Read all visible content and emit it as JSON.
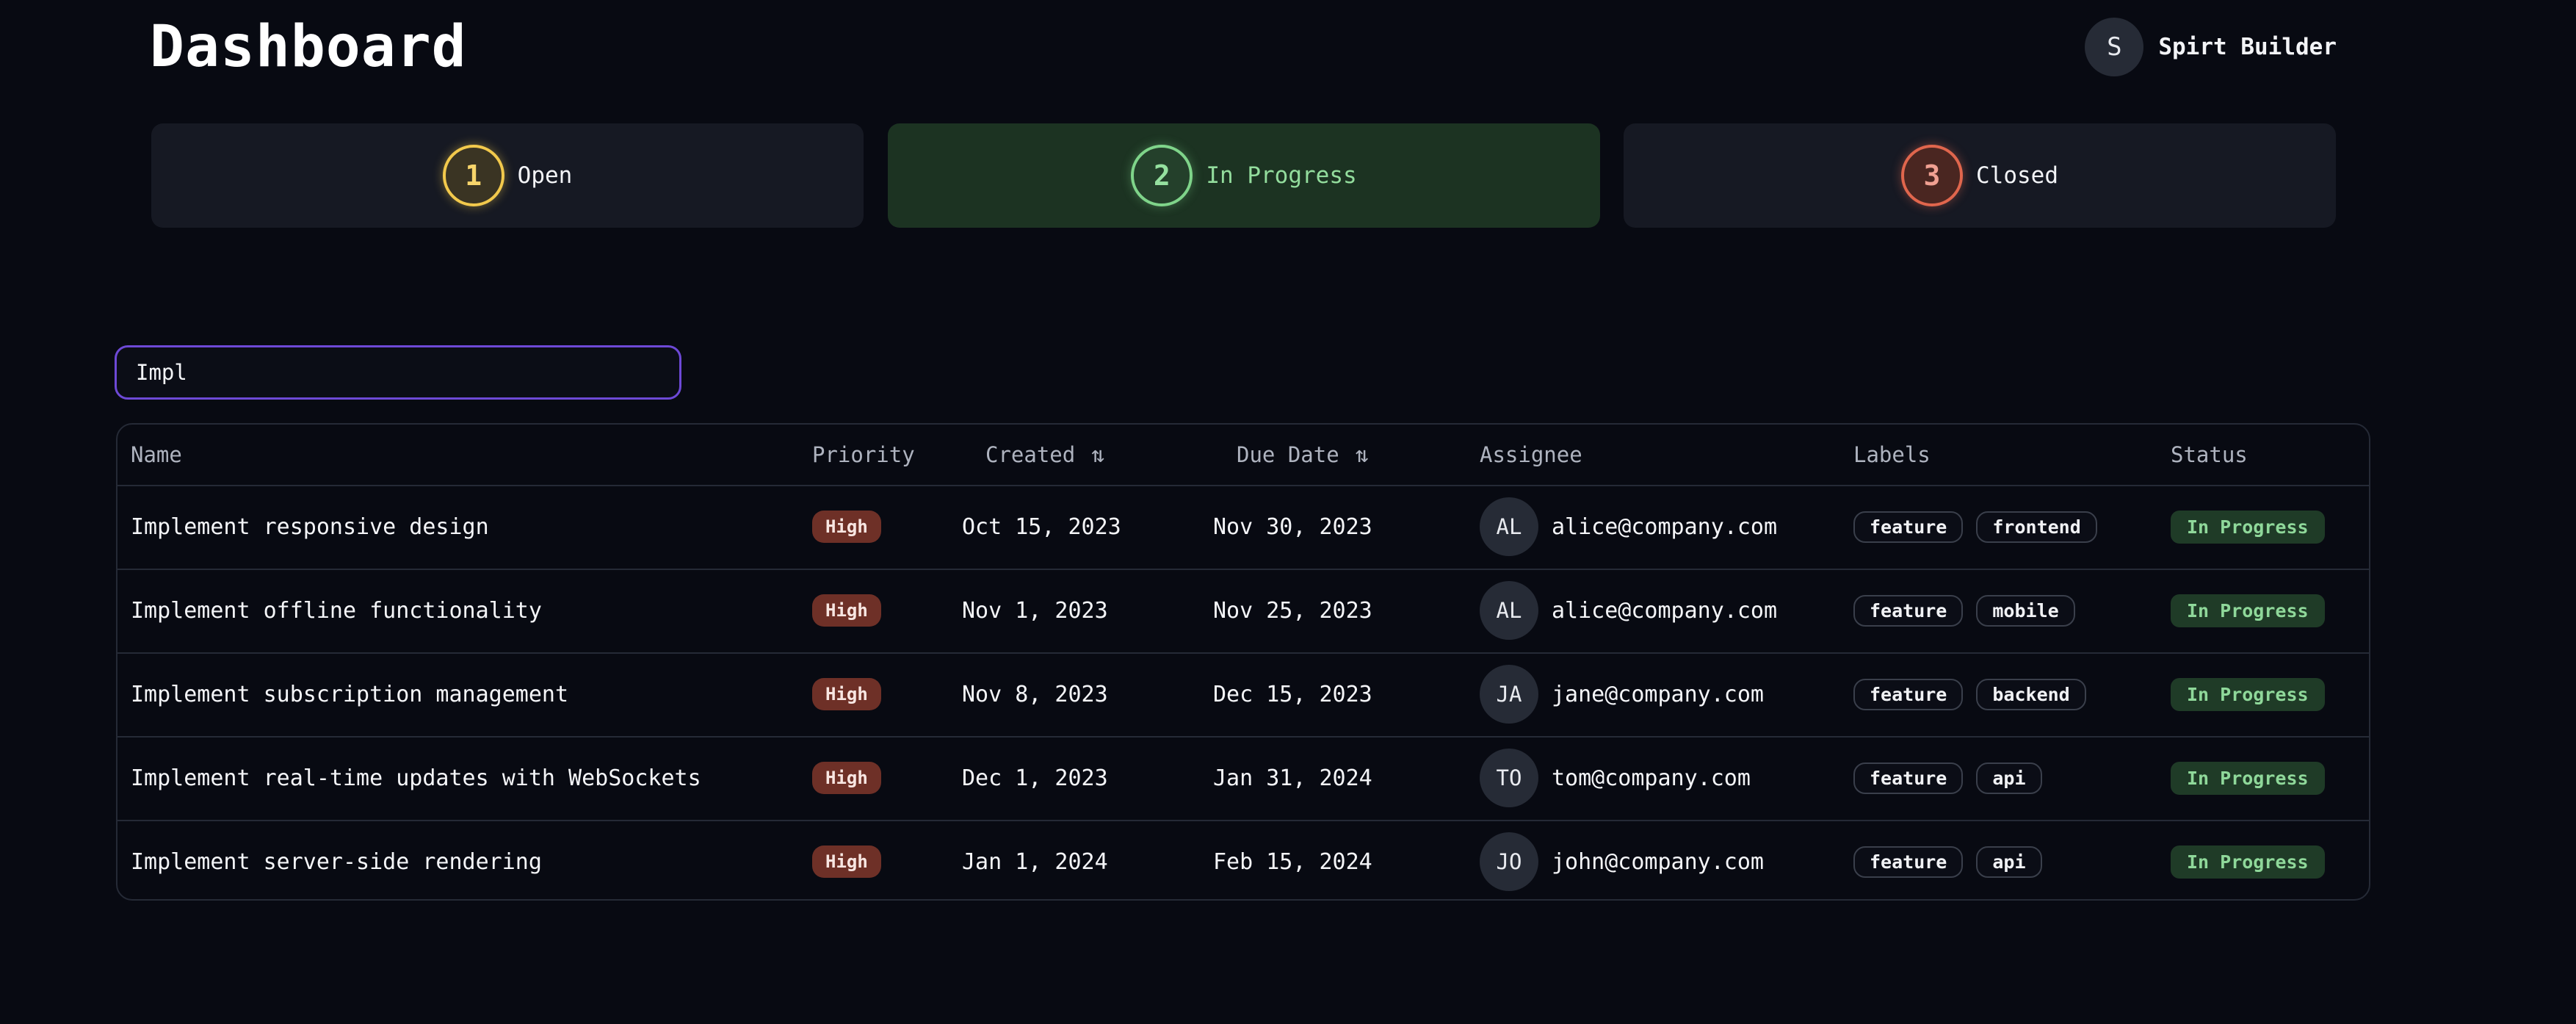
{
  "header": {
    "title": "Dashboard",
    "user_initial": "S",
    "user_name": "Spirt Builder"
  },
  "status_cards": [
    {
      "count": "1",
      "label": "Open",
      "color": "#f2c94c",
      "active": false
    },
    {
      "count": "2",
      "label": "In Progress",
      "color": "#7fd48a",
      "active": true
    },
    {
      "count": "3",
      "label": "Closed",
      "color": "#e0664d",
      "active": false
    }
  ],
  "search": {
    "value": "Impl",
    "placeholder": ""
  },
  "table": {
    "columns": {
      "name": "Name",
      "priority": "Priority",
      "created": "Created",
      "due_date": "Due Date",
      "assignee": "Assignee",
      "labels": "Labels",
      "status": "Status"
    },
    "sort_icon": "sort-arrows-icon",
    "rows": [
      {
        "name": "Implement responsive design",
        "priority": "High",
        "created": "Oct 15, 2023",
        "due": "Nov 30, 2023",
        "assignee_initials": "AL",
        "assignee": "alice@company.com",
        "labels": [
          "feature",
          "frontend"
        ],
        "status": "In Progress"
      },
      {
        "name": "Implement offline functionality",
        "priority": "High",
        "created": "Nov 1, 2023",
        "due": "Nov 25, 2023",
        "assignee_initials": "AL",
        "assignee": "alice@company.com",
        "labels": [
          "feature",
          "mobile"
        ],
        "status": "In Progress"
      },
      {
        "name": "Implement subscription management",
        "priority": "High",
        "created": "Nov 8, 2023",
        "due": "Dec 15, 2023",
        "assignee_initials": "JA",
        "assignee": "jane@company.com",
        "labels": [
          "feature",
          "backend"
        ],
        "status": "In Progress"
      },
      {
        "name": "Implement real-time updates with WebSockets",
        "priority": "High",
        "created": "Dec 1, 2023",
        "due": "Jan 31, 2024",
        "assignee_initials": "TO",
        "assignee": "tom@company.com",
        "labels": [
          "feature",
          "api"
        ],
        "status": "In Progress"
      },
      {
        "name": "Implement server-side rendering",
        "priority": "High",
        "created": "Jan 1, 2024",
        "due": "Feb 15, 2024",
        "assignee_initials": "JO",
        "assignee": "john@company.com",
        "labels": [
          "feature",
          "api"
        ],
        "status": "In Progress"
      }
    ]
  },
  "colors": {
    "background": "#080a12",
    "accent": "#6d49d6",
    "priority_high": "#6e3027",
    "status_in_progress": "#1f3b27"
  }
}
